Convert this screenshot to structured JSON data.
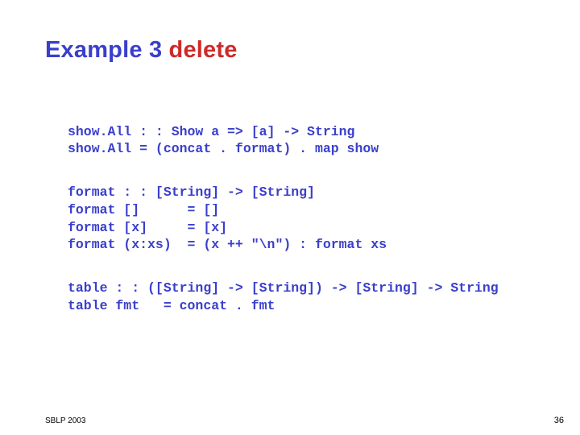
{
  "title": {
    "prefix": "Example 3",
    "highlight": "delete"
  },
  "code": {
    "block1_line1": "show.All : : Show a => [a] -> String",
    "block1_line2": "show.All = (concat . format) . map show",
    "block2_line1": "format : : [String] -> [String]",
    "block2_line2": "format []      = []",
    "block2_line3": "format [x]     = [x]",
    "block2_line4": "format (x:xs)  = (x ++ \"\\n\") : format xs",
    "block3_line1": "table : : ([String] -> [String]) -> [String] -> String",
    "block3_line2": "table fmt   = concat . fmt"
  },
  "footer": {
    "left": "SBLP 2003",
    "right": "36"
  }
}
